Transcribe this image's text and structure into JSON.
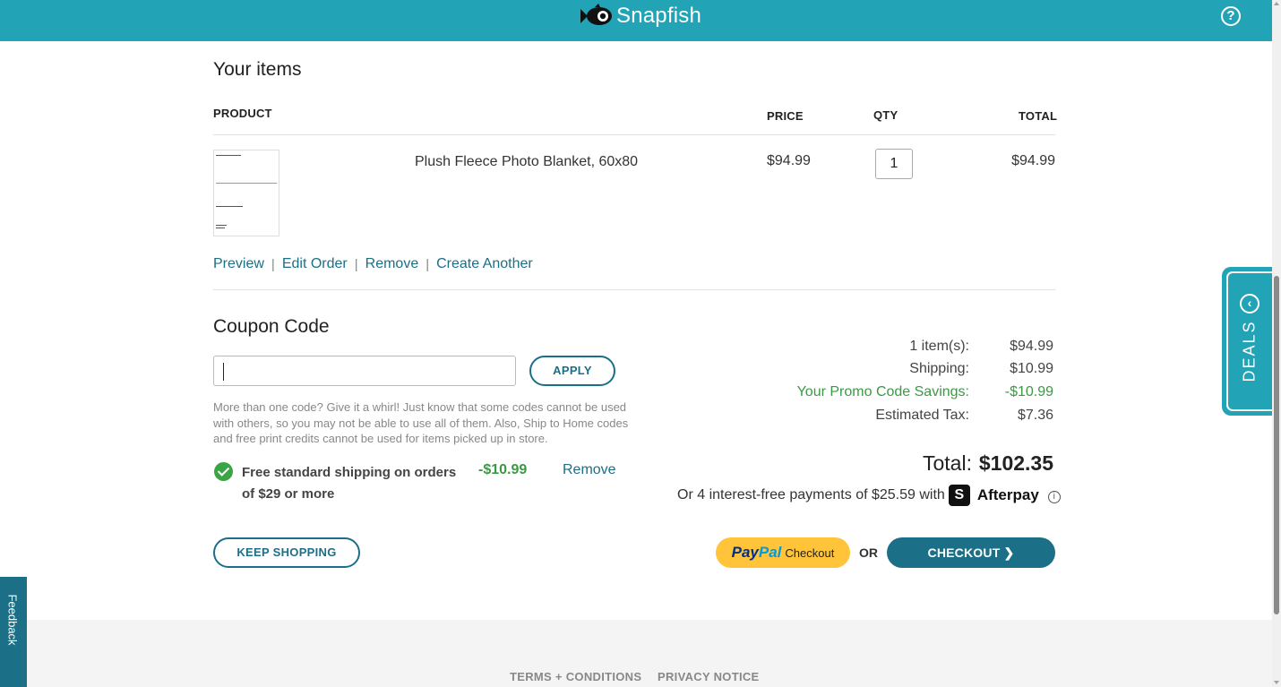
{
  "header": {
    "brand": "Snapfish",
    "help_icon": "help-icon",
    "help_glyph": "?"
  },
  "items_section": {
    "title": "Your items",
    "columns": {
      "product": "PRODUCT",
      "price": "PRICE",
      "qty": "QTY",
      "total": "TOTAL"
    },
    "item": {
      "name": "Plush Fleece Photo Blanket, 60x80",
      "price": "$94.99",
      "qty": "1",
      "total": "$94.99",
      "actions": [
        "Preview",
        "Edit Order",
        "Remove",
        "Create Another"
      ]
    }
  },
  "coupon": {
    "title": "Coupon Code",
    "input_value": "",
    "apply_label": "APPLY",
    "help_text": "More than one code? Give it a whirl! Just know that some codes cannot be used with others, so you may not be able to use all of them. Also, Ship to Home codes and free print credits cannot be used for items picked up in store.",
    "applied_promo": {
      "description": "Free standard shipping on orders of $29 or more",
      "amount": "-$10.99",
      "remove_label": "Remove"
    }
  },
  "summary": {
    "items_label": "1 item(s):",
    "items_value": "$94.99",
    "shipping_label": "Shipping:",
    "shipping_value": "$10.99",
    "promo_label": "Your Promo Code Savings:",
    "promo_value": "-$10.99",
    "tax_label": "Estimated Tax:",
    "tax_value": "$7.36",
    "total_label": "Total:",
    "total_value": "$102.35",
    "afterpay_text": "Or 4 interest-free payments of $25.59 with",
    "afterpay_name": "Afterpay",
    "afterpay_glyph": "S",
    "info_glyph": "i"
  },
  "buttons": {
    "keep_shopping": "KEEP SHOPPING",
    "paypal_a": "Pay",
    "paypal_b": "Pal",
    "paypal_c": "Checkout",
    "or": "OR",
    "checkout": "CHECKOUT ❯"
  },
  "footer": {
    "terms": "TERMS + CONDITIONS",
    "privacy": "PRIVACY NOTICE"
  },
  "side_tabs": {
    "deals": "DEALS",
    "deals_glyph": "‹",
    "feedback": "Feedback"
  },
  "colors": {
    "brand_teal": "#22a3b6",
    "dark_teal": "#1b6f86",
    "promo_green": "#3a9a43",
    "paypal_yellow": "#ffc43a"
  }
}
